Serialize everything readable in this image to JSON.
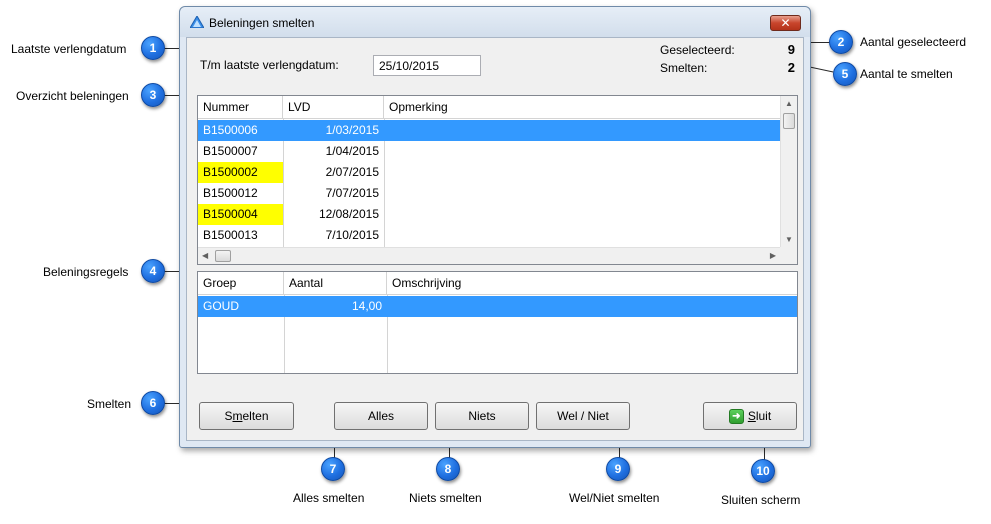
{
  "window": {
    "title": "Beleningen smelten",
    "close_glyph": "✕"
  },
  "form": {
    "date_label": "T/m laatste verlengdatum:",
    "date_value": "25/10/2015",
    "selected_label": "Geselecteerd:",
    "selected_value": "9",
    "melt_label": "Smelten:",
    "melt_value": "2"
  },
  "pledges_grid": {
    "columns": [
      "Nummer",
      "LVD",
      "Opmerking"
    ],
    "rows": [
      {
        "nummer": "B1500006",
        "lvd": "1/03/2015",
        "opmerking": "",
        "selected": true,
        "highlight": false
      },
      {
        "nummer": "B1500007",
        "lvd": "1/04/2015",
        "opmerking": "",
        "selected": false,
        "highlight": false
      },
      {
        "nummer": "B1500002",
        "lvd": "2/07/2015",
        "opmerking": "",
        "selected": false,
        "highlight": true
      },
      {
        "nummer": "B1500012",
        "lvd": "7/07/2015",
        "opmerking": "",
        "selected": false,
        "highlight": false
      },
      {
        "nummer": "B1500004",
        "lvd": "12/08/2015",
        "opmerking": "",
        "selected": false,
        "highlight": true
      },
      {
        "nummer": "B1500013",
        "lvd": "7/10/2015",
        "opmerking": "",
        "selected": false,
        "highlight": false
      }
    ]
  },
  "lines_grid": {
    "columns": [
      "Groep",
      "Aantal",
      "Omschrijving"
    ],
    "rows": [
      {
        "groep": "GOUD",
        "aantal": "14,00",
        "omschrijving": "",
        "selected": true
      }
    ]
  },
  "buttons": {
    "smelten": {
      "pre": "S",
      "u": "m",
      "post": "elten"
    },
    "alles": "Alles",
    "niets": "Niets",
    "wel_niet": "Wel / Niet",
    "sluit": {
      "pre": "",
      "u": "S",
      "post": "luit"
    }
  },
  "callouts": [
    {
      "n": "1",
      "label": "Laatste verlengdatum"
    },
    {
      "n": "2",
      "label": "Aantal geselecteerd"
    },
    {
      "n": "3",
      "label": "Overzicht beleningen"
    },
    {
      "n": "4",
      "label": "Beleningsregels"
    },
    {
      "n": "5",
      "label": "Aantal te smelten"
    },
    {
      "n": "6",
      "label": "Smelten"
    },
    {
      "n": "7",
      "label": "Alles smelten"
    },
    {
      "n": "8",
      "label": "Niets smelten"
    },
    {
      "n": "9",
      "label": "Wel/Niet smelten"
    },
    {
      "n": "10",
      "label": "Sluiten scherm"
    }
  ],
  "colors": {
    "selection": "#3399ff",
    "highlight": "#ffff00",
    "badge": "#1f6fe0"
  },
  "icons": {
    "app": "triangle-app-icon",
    "close": "close-icon",
    "exit": "exit-door-icon"
  }
}
